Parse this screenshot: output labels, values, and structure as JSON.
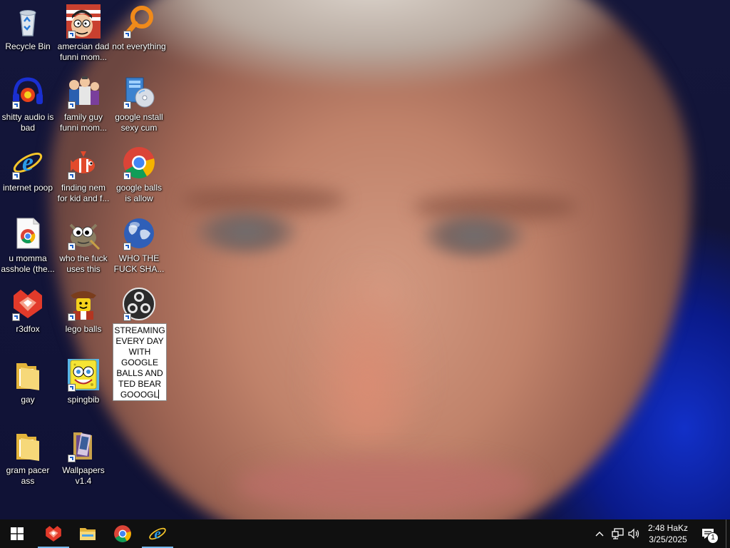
{
  "desktop": {
    "icons": [
      {
        "label": "Recycle Bin",
        "icon": "recycle-bin-icon",
        "shortcut": false
      },
      {
        "label": "amercian dad funni mom...",
        "icon": "cartoon-character-icon",
        "shortcut": true
      },
      {
        "label": "not everything",
        "icon": "search-magnifier-icon",
        "shortcut": true
      },
      {
        "label": "shitty audio is bad",
        "icon": "audio-icon",
        "shortcut": true
      },
      {
        "label": "family guy funni mom...",
        "icon": "cartoon-characters-icon",
        "shortcut": true
      },
      {
        "label": "google nstall sexy cum",
        "icon": "installer-icon",
        "shortcut": true
      },
      {
        "label": "internet poop",
        "icon": "internet-explorer-icon",
        "shortcut": true
      },
      {
        "label": "finding nem for kid and f...",
        "icon": "fish-icon",
        "shortcut": true
      },
      {
        "label": "google balls is allow",
        "icon": "chrome-icon",
        "shortcut": true
      },
      {
        "label": "u momma asshole (the...",
        "icon": "chrome-document-icon",
        "shortcut": false
      },
      {
        "label": "who the fuck uses this",
        "icon": "gimp-icon",
        "shortcut": true
      },
      {
        "label": "WHO THE FUCK SHA...",
        "icon": "globe-icon",
        "shortcut": true
      },
      {
        "label": "r3dfox",
        "icon": "fox-browser-icon",
        "shortcut": true
      },
      {
        "label": "lego balls",
        "icon": "lego-figure-icon",
        "shortcut": true
      },
      {
        "label": "gay",
        "icon": "folder-icon",
        "shortcut": false
      },
      {
        "label": "spingbib",
        "icon": "sponge-character-icon",
        "shortcut": true
      },
      {
        "label": "gram pacer ass",
        "icon": "folder-icon",
        "shortcut": false
      },
      {
        "label": "Wallpapers v1.4",
        "icon": "wallpapers-icon",
        "shortcut": true
      }
    ],
    "rename": {
      "icon": "obs-icon",
      "text": "STREAMING EVERY DAY WITH GOOGLE BALLS AND TED BEAR GOOOGL"
    }
  },
  "taskbar": {
    "start_icon": "windows-start-icon",
    "pinned": [
      {
        "name": "r3dfox",
        "icon": "fox-browser-icon",
        "running": true
      },
      {
        "name": "File Explorer",
        "icon": "folder-icon",
        "running": false
      },
      {
        "name": "Google Chrome",
        "icon": "chrome-icon",
        "running": false
      },
      {
        "name": "Internet Explorer",
        "icon": "internet-explorer-icon",
        "running": true
      }
    ],
    "clock_time": "2:48 HaKz",
    "clock_date": "3/25/2025",
    "notification_count": "1",
    "colors": {
      "taskbar": "#101010",
      "running_indicator": "#76b9ed"
    }
  }
}
